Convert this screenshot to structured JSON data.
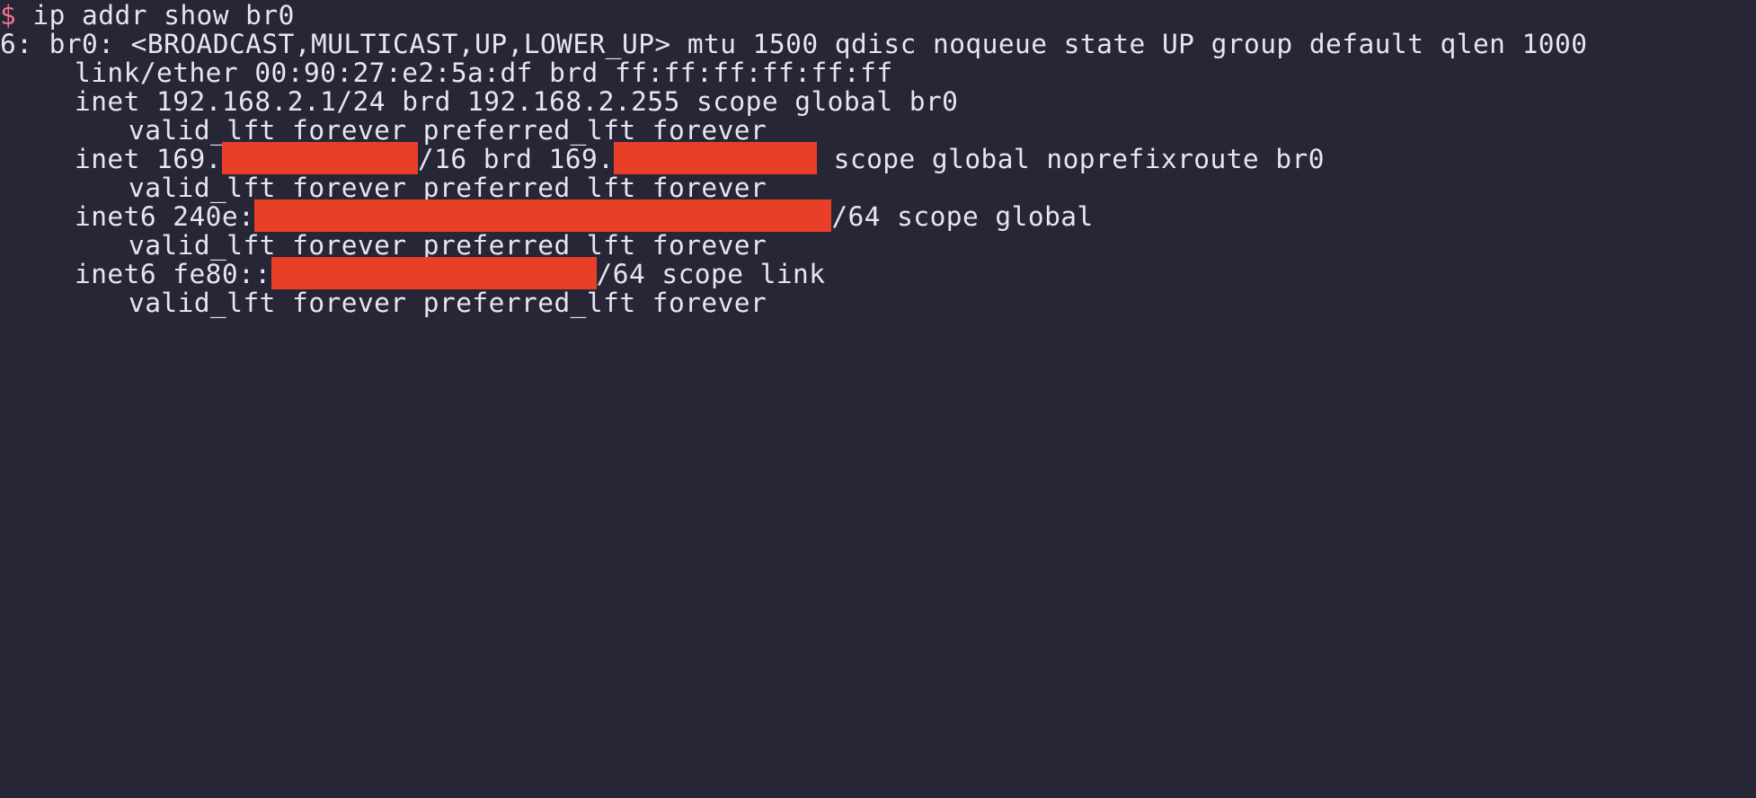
{
  "terminal": {
    "prompt_symbol": "$",
    "command": " ip addr show br0",
    "lines": {
      "iface_header": "6: br0: <BROADCAST,MULTICAST,UP,LOWER_UP> mtu 1500 qdisc noqueue state UP group default qlen 1000",
      "link_ether": "link/ether 00:90:27:e2:5a:df brd ff:ff:ff:ff:ff:ff",
      "inet1": "inet 192.168.2.1/24 brd 192.168.2.255 scope global br0",
      "inet1_lft": "valid_lft forever preferred_lft forever",
      "inet2_prefix": "inet 169.",
      "inet2_mid": "/16 brd 169.",
      "inet2_suffix": " scope global noprefixroute br0",
      "inet2_lft": "valid_lft forever preferred_lft forever",
      "inet6_1_prefix": "inet6 240e:",
      "inet6_1_suffix": "/64 scope global",
      "inet6_1_lft": "valid_lft forever preferred_lft forever",
      "inet6_2_prefix": "inet6 fe80::",
      "inet6_2_suffix": "/64 scope link",
      "inet6_2_lft": "valid_lft forever preferred_lft forever"
    }
  },
  "colors": {
    "background": "#272637",
    "foreground": "#e7e5ee",
    "prompt": "#f0718f",
    "redaction": "#e84026"
  }
}
